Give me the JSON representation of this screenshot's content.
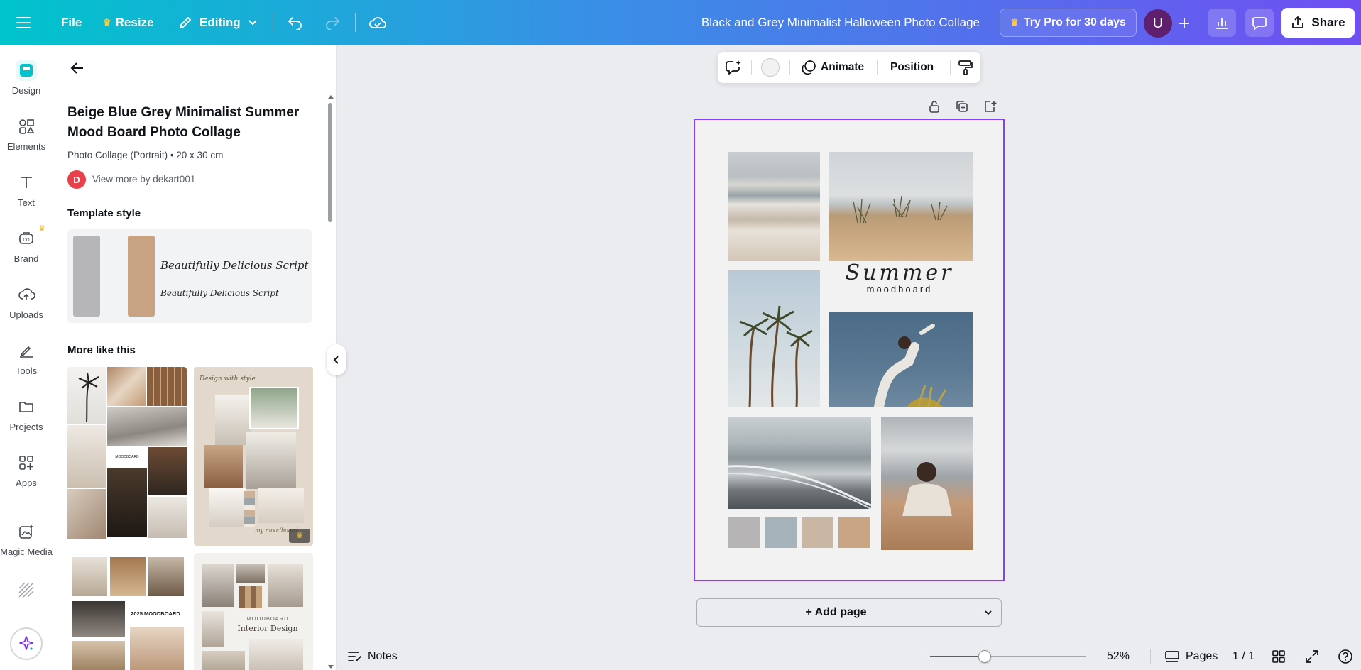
{
  "topbar": {
    "file_label": "File",
    "resize_label": "Resize",
    "editing_label": "Editing",
    "document_title": "Black and Grey Minimalist Halloween Photo Collage",
    "pro_label": "Try Pro for 30 days",
    "avatar_initial": "U",
    "share_label": "Share",
    "icons": [
      "menu-icon",
      "crown-icon",
      "pencil-icon",
      "chevron-down-icon",
      "undo-icon",
      "redo-icon",
      "cloud-sync-icon",
      "plus-icon",
      "bar-chart-icon",
      "comment-icon",
      "share-upload-icon"
    ]
  },
  "rail": {
    "items": [
      {
        "label": "Design",
        "icon": "design-icon"
      },
      {
        "label": "Elements",
        "icon": "elements-icon"
      },
      {
        "label": "Text",
        "icon": "text-icon"
      },
      {
        "label": "Brand",
        "icon": "brand-icon"
      },
      {
        "label": "Uploads",
        "icon": "upload-icon"
      },
      {
        "label": "Tools",
        "icon": "tools-icon"
      },
      {
        "label": "Projects",
        "icon": "folder-icon"
      },
      {
        "label": "Apps",
        "icon": "apps-icon"
      },
      {
        "label": "Magic Media",
        "icon": "magic-media-icon"
      }
    ],
    "accent": "#00c4cc"
  },
  "panel": {
    "template_title": "Beige Blue Grey Minimalist Summer Mood Board Photo Collage",
    "template_meta": "Photo Collage (Portrait) • 20 x 30 cm",
    "author_initial": "D",
    "author_link": "View more by dekart001",
    "style_heading": "Template style",
    "style_colors": [
      "#b6b5b7",
      "#c9a282"
    ],
    "style_font_sample": "Beautifully Delicious Script",
    "more_heading": "More like this",
    "thumbnail_texts": [
      "Design with style",
      "my moodboard",
      "2025 MOODBOARD",
      "MOODBOARD",
      "Interior Design"
    ]
  },
  "context_toolbar": {
    "animate_label": "Animate",
    "position_label": "Position"
  },
  "page": {
    "heading_script": "Summer",
    "heading_sub": "moodboard",
    "swatches": [
      "#b6b4b4",
      "#a6b3bb",
      "#c9b7a3",
      "#caa583"
    ],
    "border_color": "#8b3dff"
  },
  "add_page_label": "+ Add page",
  "bottombar": {
    "notes_label": "Notes",
    "zoom": "52%",
    "zoom_fraction": 0.35,
    "pages_label": "Pages",
    "page_counter": "1 / 1"
  }
}
